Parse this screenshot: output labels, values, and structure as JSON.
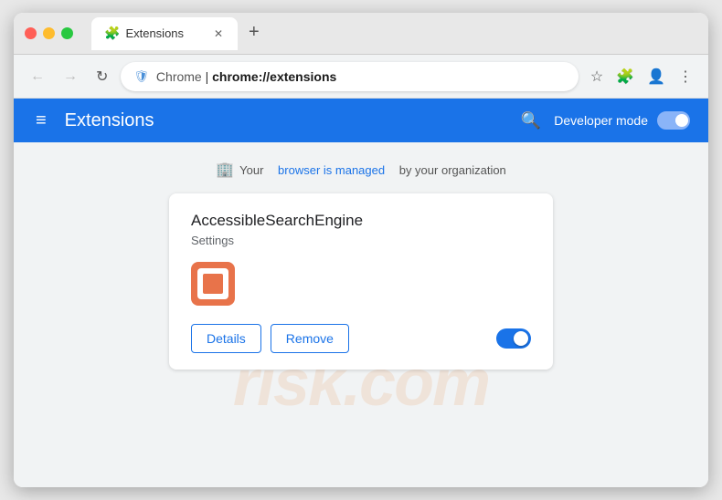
{
  "browser": {
    "tab_title": "Extensions",
    "tab_icon": "puzzle-icon",
    "new_tab_icon": "+",
    "address": {
      "origin": "Chrome",
      "separator": " | ",
      "path": "chrome://extensions"
    },
    "nav": {
      "back": "←",
      "forward": "→",
      "refresh": "↻"
    }
  },
  "extensions_page": {
    "header": {
      "menu_icon": "≡",
      "title": "Extensions",
      "search_icon": "search",
      "developer_mode_label": "Developer mode",
      "toggle_state": "on"
    },
    "managed_notice": {
      "icon": "building-icon",
      "text_before": "Your",
      "link_text": "browser is managed",
      "text_after": "by your organization"
    },
    "extension_card": {
      "name": "AccessibleSearchEngine",
      "subtitle": "Settings",
      "logo_alt": "extension-logo",
      "buttons": {
        "details": "Details",
        "remove": "Remove"
      },
      "enabled": true
    }
  },
  "watermark": {
    "text": "risk.com"
  }
}
